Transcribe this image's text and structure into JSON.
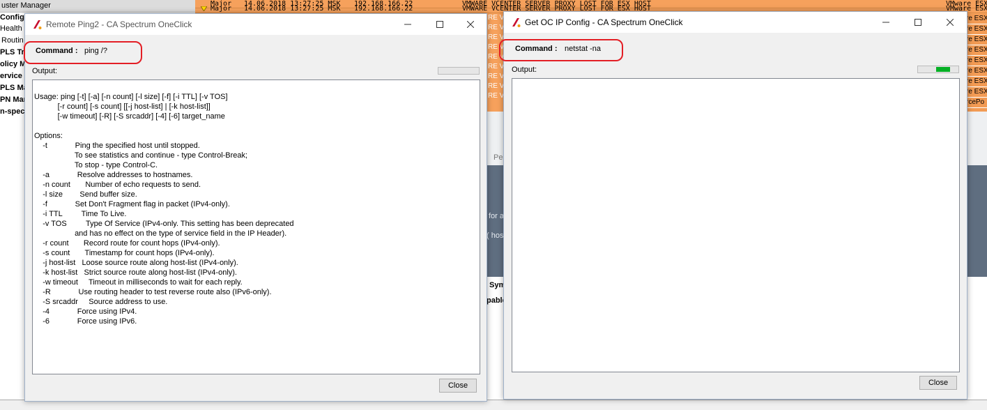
{
  "background": {
    "tree_items": [
      "uster Manager",
      "Configur",
      "Health M",
      "Routin",
      "PLS Tra",
      "olicy M",
      "ervice",
      "PLS Man",
      "PN Man",
      "n-spect"
    ],
    "alarms": [
      {
        "severity": "Major",
        "date": "14.06.2018 13:27:25 MSK",
        "ip": "192.168.166.22",
        "title": "VMWARE VCENTER SERVER PROXY LOST FOR ESX HOST",
        "model": "VMware ESX"
      },
      {
        "severity": "Major",
        "date": "14.06.2018 13:27:25 MSK",
        "ip": "192.168.166.22",
        "title": "VMWARE VCENTER SERVER PROXY LOST FOR ESX HOST",
        "model": "VMware ESX"
      }
    ],
    "right_column": [
      "re ESX",
      "re ESX",
      "re ESX",
      "re ESX",
      "re ESX",
      "re ESX",
      "re ESX",
      "re ESX",
      "rcePo"
    ],
    "vc_fragments": [
      "RE VC",
      "RE VC",
      "RE VC",
      "RE VC",
      "RE VC",
      "RE VC",
      "RE VC",
      "RE VC",
      "RE VC"
    ],
    "frag_per": "Per",
    "frag_for": "for a",
    "frag_host": "( host",
    "frag_sym": "Sym",
    "frag_able": "pable",
    "sev_color": "#f6a15c"
  },
  "ping_dialog": {
    "title": "Remote Ping2 - CA Spectrum OneClick",
    "command_label": "Command :",
    "command_value": "ping /?",
    "output_label": "Output:",
    "output_text": "Usage: ping [-t] [-a] [-n count] [-l size] [-f] [-i TTL] [-v TOS]\n           [-r count] [-s count] [[-j host-list] | [-k host-list]]\n           [-w timeout] [-R] [-S srcaddr] [-4] [-6] target_name\n\nOptions:\n    -t             Ping the specified host until stopped.\n                   To see statistics and continue - type Control-Break;\n                   To stop - type Control-C.\n    -a             Resolve addresses to hostnames.\n    -n count       Number of echo requests to send.\n    -l size        Send buffer size.\n    -f             Set Don't Fragment flag in packet (IPv4-only).\n    -i TTL         Time To Live.\n    -v TOS         Type Of Service (IPv4-only. This setting has been deprecated\n                   and has no effect on the type of service field in the IP Header).\n    -r count       Record route for count hops (IPv4-only).\n    -s count       Timestamp for count hops (IPv4-only).\n    -j host-list   Loose source route along host-list (IPv4-only).\n    -k host-list   Strict source route along host-list (IPv4-only).\n    -w timeout     Timeout in milliseconds to wait for each reply.\n    -R             Use routing header to test reverse route also (IPv6-only).\n    -S srcaddr     Source address to use.\n    -4             Force using IPv4.\n    -6             Force using IPv6.",
    "progress": 0,
    "close_label": "Close"
  },
  "netstat_dialog": {
    "title": "Get OC IP Config - CA Spectrum OneClick",
    "command_label": "Command :",
    "command_value": "netstat -na",
    "output_label": "Output:",
    "output_text": "",
    "progress": 0.35,
    "close_label": "Close"
  },
  "colors": {
    "highlight_circle": "#e31e25",
    "progress_green": "#06b025",
    "app_icon_red": "#c8102e"
  }
}
